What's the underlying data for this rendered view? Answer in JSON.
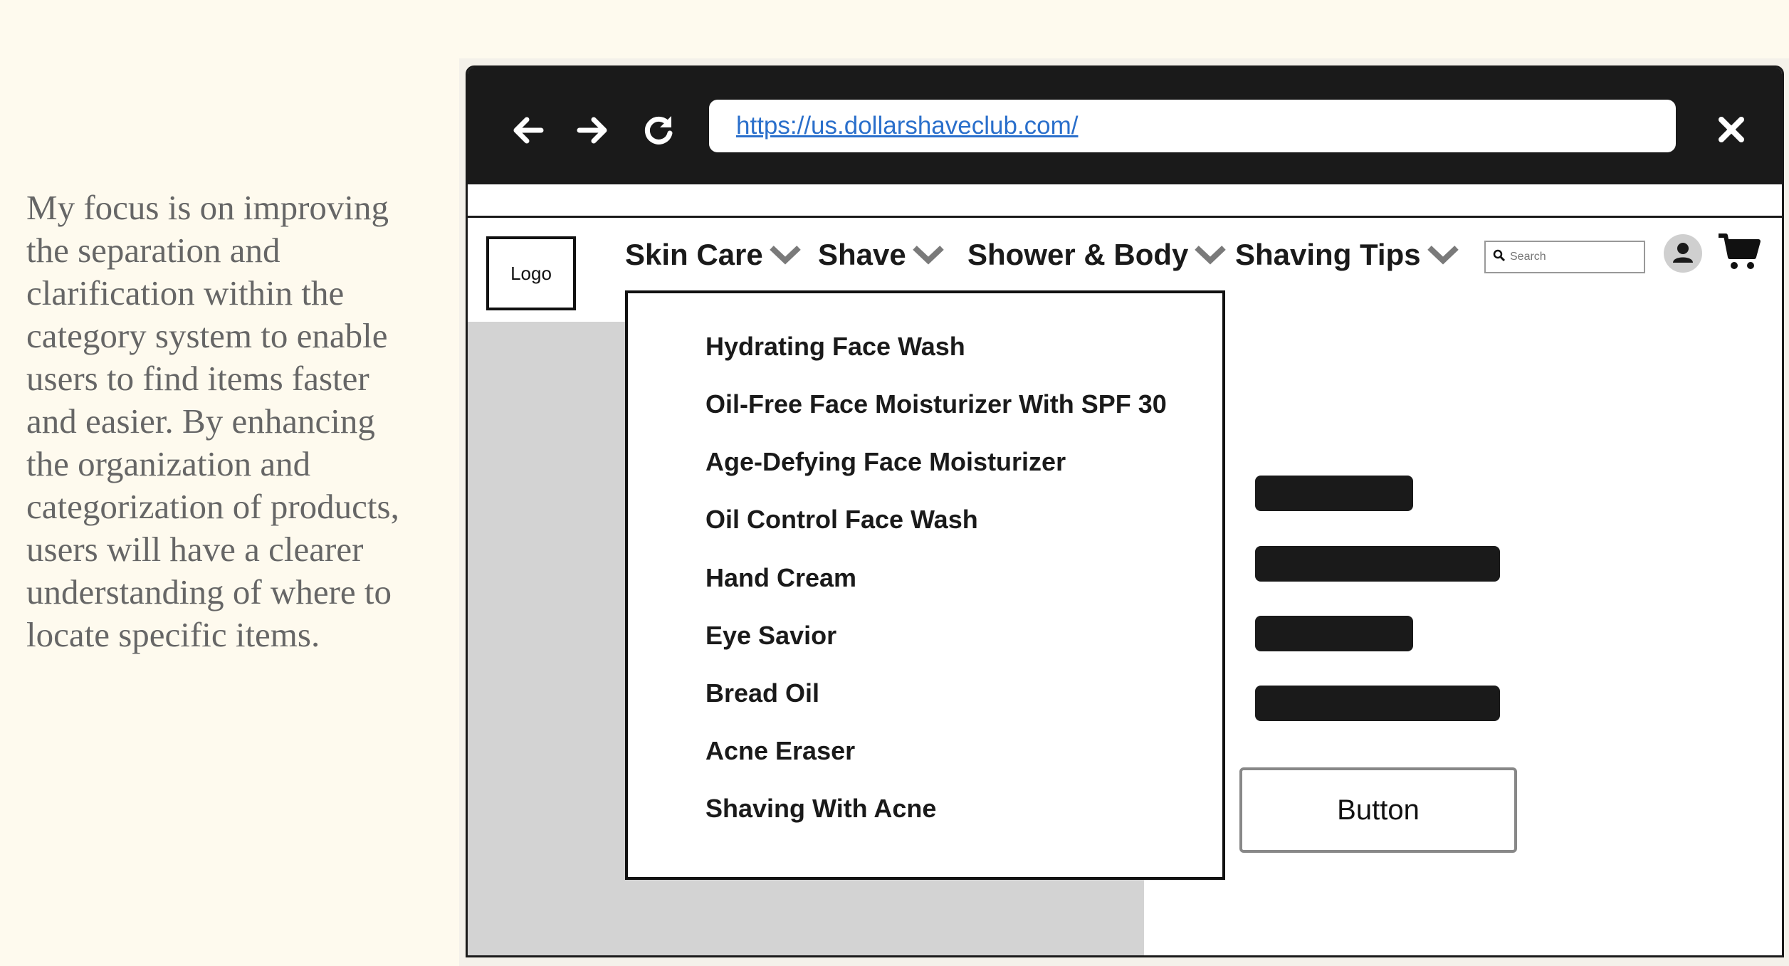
{
  "caption": "My focus is on improving the separation and clarification within the category system to enable users to find items faster and easier. By enhancing the organization and categorization of products, users will have a clearer understanding of where to locate specific items.",
  "browser": {
    "url": "https://us.dollarshaveclub.com/",
    "back_icon": "arrow-left-icon",
    "forward_icon": "arrow-right-icon",
    "reload_icon": "reload-icon",
    "close_icon": "close-icon"
  },
  "header": {
    "logo": "Logo",
    "nav": [
      {
        "label": "Skin Care",
        "icon": "chevron-down-icon"
      },
      {
        "label": "Shave",
        "icon": "chevron-down-icon"
      },
      {
        "label": "Shower & Body",
        "icon": "chevron-down-icon"
      },
      {
        "label": "Shaving Tips",
        "icon": "chevron-down-icon"
      }
    ],
    "search_placeholder": "Search",
    "account_icon": "user-icon",
    "cart_icon": "cart-icon"
  },
  "dropdown": {
    "items": [
      "Hydrating Face Wash",
      "Oil-Free Face Moisturizer With SPF 30",
      "Age-Defying Face Moisturizer",
      "Oil Control Face Wash",
      "Hand Cream",
      "Eye Savior",
      "Bread Oil",
      "Acne Eraser",
      "Shaving With Acne"
    ]
  },
  "content": {
    "button_label": "Button"
  },
  "colors": {
    "page_background": "#FEFAEE",
    "browser_chrome": "#1A1A1A",
    "link": "#2A6FCB",
    "placeholder_gray": "#D3D3D3",
    "caption_text": "#666666"
  }
}
